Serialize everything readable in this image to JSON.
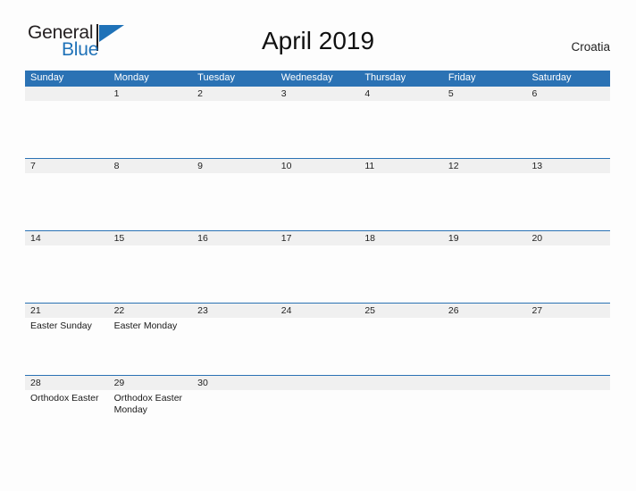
{
  "brand": {
    "name_part1": "General",
    "name_part2": "Blue",
    "flag_icon": "blue-flag-triangle"
  },
  "header": {
    "title": "April 2019",
    "region": "Croatia"
  },
  "colors": {
    "header_blue": "#2b72b4",
    "date_strip_gray": "#f0f0f0",
    "brand_blue": "#1f72b8",
    "text_dark": "#222222"
  },
  "calendar": {
    "weekdays": [
      "Sunday",
      "Monday",
      "Tuesday",
      "Wednesday",
      "Thursday",
      "Friday",
      "Saturday"
    ],
    "weeks": [
      [
        {
          "day": "",
          "event": ""
        },
        {
          "day": "1",
          "event": ""
        },
        {
          "day": "2",
          "event": ""
        },
        {
          "day": "3",
          "event": ""
        },
        {
          "day": "4",
          "event": ""
        },
        {
          "day": "5",
          "event": ""
        },
        {
          "day": "6",
          "event": ""
        }
      ],
      [
        {
          "day": "7",
          "event": ""
        },
        {
          "day": "8",
          "event": ""
        },
        {
          "day": "9",
          "event": ""
        },
        {
          "day": "10",
          "event": ""
        },
        {
          "day": "11",
          "event": ""
        },
        {
          "day": "12",
          "event": ""
        },
        {
          "day": "13",
          "event": ""
        }
      ],
      [
        {
          "day": "14",
          "event": ""
        },
        {
          "day": "15",
          "event": ""
        },
        {
          "day": "16",
          "event": ""
        },
        {
          "day": "17",
          "event": ""
        },
        {
          "day": "18",
          "event": ""
        },
        {
          "day": "19",
          "event": ""
        },
        {
          "day": "20",
          "event": ""
        }
      ],
      [
        {
          "day": "21",
          "event": "Easter Sunday"
        },
        {
          "day": "22",
          "event": "Easter Monday"
        },
        {
          "day": "23",
          "event": ""
        },
        {
          "day": "24",
          "event": ""
        },
        {
          "day": "25",
          "event": ""
        },
        {
          "day": "26",
          "event": ""
        },
        {
          "day": "27",
          "event": ""
        }
      ],
      [
        {
          "day": "28",
          "event": "Orthodox Easter"
        },
        {
          "day": "29",
          "event": "Orthodox Easter Monday"
        },
        {
          "day": "30",
          "event": ""
        },
        {
          "day": "",
          "event": ""
        },
        {
          "day": "",
          "event": ""
        },
        {
          "day": "",
          "event": ""
        },
        {
          "day": "",
          "event": ""
        }
      ]
    ]
  }
}
